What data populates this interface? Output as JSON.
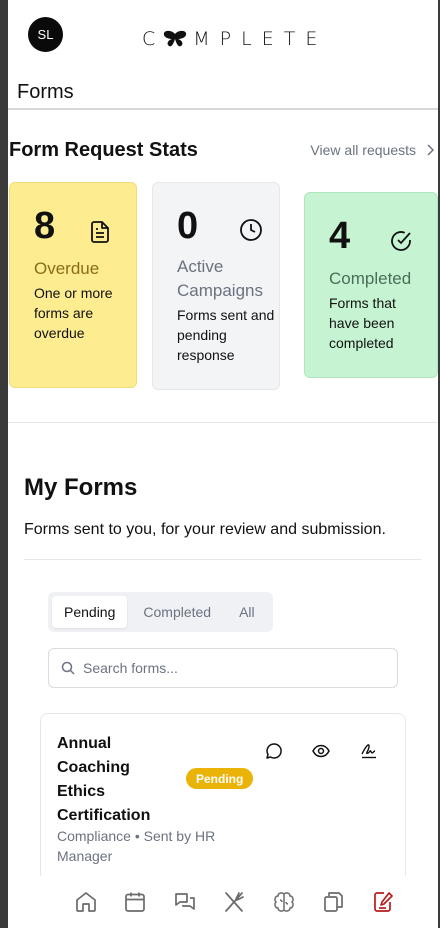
{
  "header": {
    "avatar_initials": "SL",
    "logo_text": "COMPLETE",
    "page_title": "Forms"
  },
  "stats": {
    "title": "Form Request Stats",
    "view_all": "View all requests",
    "cards": [
      {
        "number": "8",
        "label": "Overdue",
        "description": "One or more forms are overdue",
        "icon": "document-icon",
        "color": "#fdec90"
      },
      {
        "number": "0",
        "label": "Active Campaigns",
        "description": "Forms sent and pending response",
        "icon": "clock-icon",
        "color": "#f3f4f6"
      },
      {
        "number": "4",
        "label": "Completed",
        "description": "Forms that have been completed",
        "icon": "check-circle-icon",
        "color": "#c6f4d3"
      }
    ]
  },
  "my_forms": {
    "title": "My Forms",
    "subtitle": "Forms sent to you, for your review and submission.",
    "tabs": [
      "Pending",
      "Completed",
      "All"
    ],
    "active_tab": "Pending",
    "search_placeholder": "Search forms...",
    "items": [
      {
        "title": "Annual Coaching Ethics Certification",
        "status": "Pending",
        "status_color": "#eab308",
        "meta": "Compliance • Sent by HR Manager"
      }
    ]
  },
  "nav": [
    "home-icon",
    "calendar-icon",
    "chat-icon",
    "utensils-icon",
    "brain-icon",
    "copy-icon",
    "edit-form-icon"
  ],
  "colors": {
    "active_nav": "#b91c1c",
    "text_muted": "#6b7280"
  }
}
